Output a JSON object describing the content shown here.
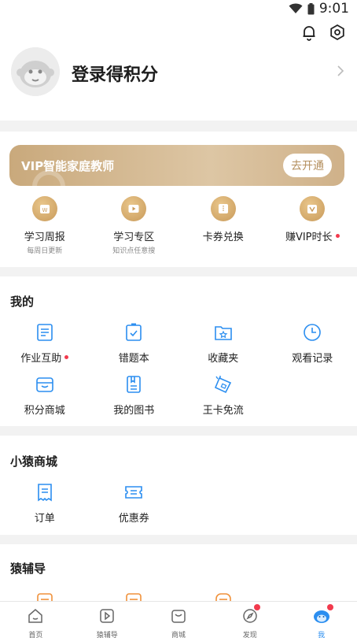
{
  "status_bar": {
    "time": "9:01"
  },
  "header": {
    "login_title": "登录得积分"
  },
  "vip": {
    "banner_title": "VIP智能家庭教师",
    "open_button": "去开通",
    "items": [
      {
        "label": "学习周报",
        "sub": "每周日更新",
        "icon": "calendar-icon"
      },
      {
        "label": "学习专区",
        "sub": "知识点任意搜",
        "icon": "video-icon"
      },
      {
        "label": "卡券兑换",
        "sub": "",
        "icon": "ticket-icon"
      },
      {
        "label": "赚VIP时长",
        "sub": "",
        "icon": "vip-gift-icon"
      }
    ]
  },
  "mine": {
    "title": "我的",
    "items": [
      {
        "label": "作业互助",
        "icon": "homework-icon"
      },
      {
        "label": "错题本",
        "icon": "mistake-book-icon"
      },
      {
        "label": "收藏夹",
        "icon": "favorites-icon"
      },
      {
        "label": "观看记录",
        "icon": "history-icon"
      },
      {
        "label": "积分商城",
        "icon": "points-mall-icon"
      },
      {
        "label": "我的图书",
        "icon": "books-icon"
      },
      {
        "label": "王卡免流",
        "icon": "sim-card-icon"
      }
    ]
  },
  "shop": {
    "title": "小猿商城",
    "items": [
      {
        "label": "订单",
        "icon": "order-icon"
      },
      {
        "label": "优惠券",
        "icon": "coupon-icon"
      }
    ]
  },
  "tutor": {
    "title": "猿辅导"
  },
  "tabbar": {
    "tabs": [
      {
        "label": "首页",
        "icon": "home-icon"
      },
      {
        "label": "猿辅导",
        "icon": "play-icon"
      },
      {
        "label": "商城",
        "icon": "shop-icon"
      },
      {
        "label": "发现",
        "icon": "compass-icon"
      },
      {
        "label": "我",
        "icon": "profile-icon"
      }
    ]
  },
  "colors": {
    "accent": "#2b8ef0",
    "vip_gold": "#c9a97c",
    "badge_red": "#f23a4d"
  }
}
